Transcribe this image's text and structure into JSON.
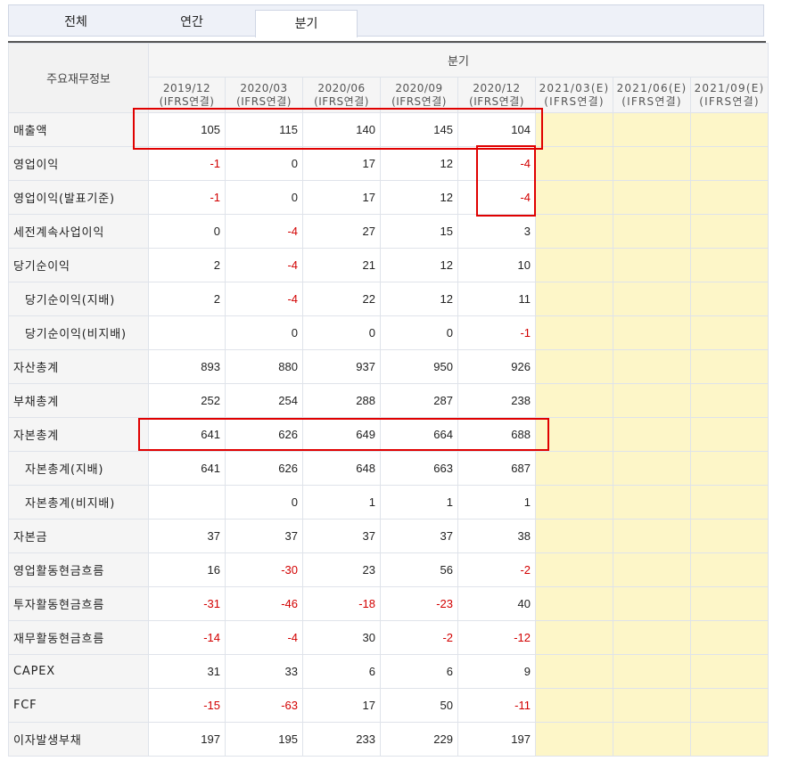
{
  "tabs": [
    {
      "label": "전체",
      "active": false
    },
    {
      "label": "연간",
      "active": false
    },
    {
      "label": "분기",
      "active": true
    }
  ],
  "table": {
    "corner_label": "주요재무정보",
    "group_label": "분기",
    "periods": [
      {
        "date": "2019/12",
        "sub": "(IFRS연결)",
        "estimate": false
      },
      {
        "date": "2020/03",
        "sub": "(IFRS연결)",
        "estimate": false
      },
      {
        "date": "2020/06",
        "sub": "(IFRS연결)",
        "estimate": false
      },
      {
        "date": "2020/09",
        "sub": "(IFRS연결)",
        "estimate": false
      },
      {
        "date": "2020/12",
        "sub": "(IFRS연결)",
        "estimate": false
      },
      {
        "date": "2021/03(E)",
        "sub": "(IFRS연결)",
        "estimate": true
      },
      {
        "date": "2021/06(E)",
        "sub": "(IFRS연결)",
        "estimate": true
      },
      {
        "date": "2021/09(E)",
        "sub": "(IFRS연결)",
        "estimate": true
      }
    ],
    "rows": [
      {
        "label": "매출액",
        "indent": false,
        "values": [
          "105",
          "115",
          "140",
          "145",
          "104"
        ]
      },
      {
        "label": "영업이익",
        "indent": false,
        "values": [
          "-1",
          "0",
          "17",
          "12",
          "-4"
        ]
      },
      {
        "label": "영업이익(발표기준)",
        "indent": false,
        "values": [
          "-1",
          "0",
          "17",
          "12",
          "-4"
        ]
      },
      {
        "label": "세전계속사업이익",
        "indent": false,
        "values": [
          "0",
          "-4",
          "27",
          "15",
          "3"
        ]
      },
      {
        "label": "당기순이익",
        "indent": false,
        "values": [
          "2",
          "-4",
          "21",
          "12",
          "10"
        ]
      },
      {
        "label": "당기순이익(지배)",
        "indent": true,
        "values": [
          "2",
          "-4",
          "22",
          "12",
          "11"
        ]
      },
      {
        "label": "당기순이익(비지배)",
        "indent": true,
        "values": [
          "",
          "0",
          "0",
          "0",
          "-1"
        ]
      },
      {
        "label": "자산총계",
        "indent": false,
        "values": [
          "893",
          "880",
          "937",
          "950",
          "926"
        ]
      },
      {
        "label": "부채총계",
        "indent": false,
        "values": [
          "252",
          "254",
          "288",
          "287",
          "238"
        ]
      },
      {
        "label": "자본총계",
        "indent": false,
        "values": [
          "641",
          "626",
          "649",
          "664",
          "688"
        ]
      },
      {
        "label": "자본총계(지배)",
        "indent": true,
        "values": [
          "641",
          "626",
          "648",
          "663",
          "687"
        ]
      },
      {
        "label": "자본총계(비지배)",
        "indent": true,
        "values": [
          "",
          "0",
          "1",
          "1",
          "1"
        ]
      },
      {
        "label": "자본금",
        "indent": false,
        "values": [
          "37",
          "37",
          "37",
          "37",
          "38"
        ]
      },
      {
        "label": "영업활동현금흐름",
        "indent": false,
        "values": [
          "16",
          "-30",
          "23",
          "56",
          "-2"
        ]
      },
      {
        "label": "투자활동현금흐름",
        "indent": false,
        "values": [
          "-31",
          "-46",
          "-18",
          "-23",
          "40"
        ]
      },
      {
        "label": "재무활동현금흐름",
        "indent": false,
        "values": [
          "-14",
          "-4",
          "30",
          "-2",
          "-12"
        ]
      },
      {
        "label": "CAPEX",
        "indent": false,
        "values": [
          "31",
          "33",
          "6",
          "6",
          "9"
        ]
      },
      {
        "label": "FCF",
        "indent": false,
        "values": [
          "-15",
          "-63",
          "17",
          "50",
          "-11"
        ]
      },
      {
        "label": "이자발생부채",
        "indent": false,
        "values": [
          "197",
          "195",
          "233",
          "229",
          "197"
        ]
      }
    ]
  },
  "colors": {
    "negative": "#d20000",
    "estimate_bg": "#fdf6c8",
    "highlight_box": "#e00000"
  }
}
